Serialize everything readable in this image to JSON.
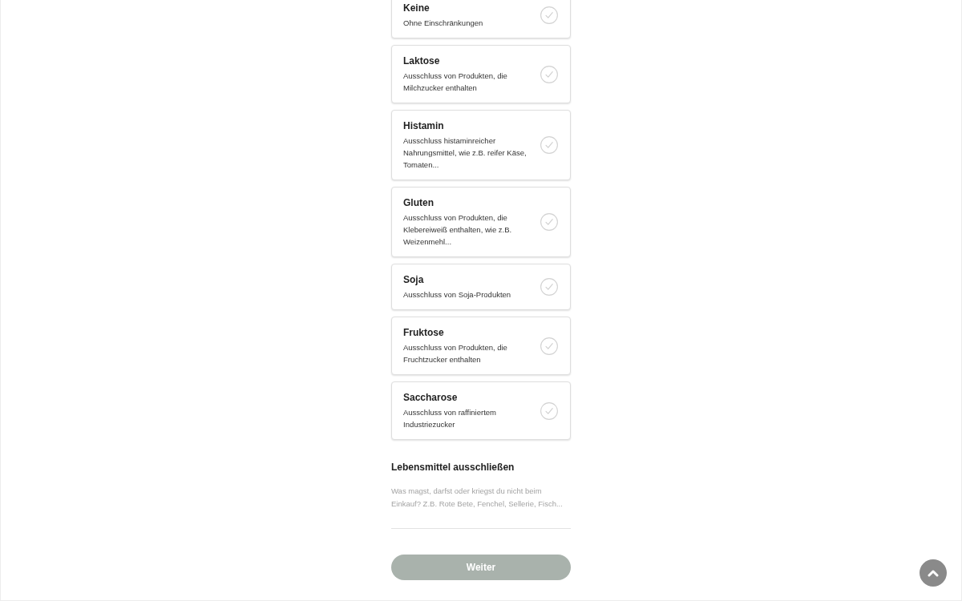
{
  "options": [
    {
      "title": "Keine",
      "description": "Ohne Einschränkungen",
      "selected": false
    },
    {
      "title": "Laktose",
      "description": "Ausschluss von Produkten, die Milchzucker enthalten",
      "selected": false
    },
    {
      "title": "Histamin",
      "description": "Ausschluss histaminreicher Nahrungsmittel, wie z.B. reifer Käse, Tomaten...",
      "selected": false
    },
    {
      "title": "Gluten",
      "description": "Ausschluss von Produkten, die Klebereiweiß enthalten, wie z.B. Weizenmehl...",
      "selected": false
    },
    {
      "title": "Soja",
      "description": "Ausschluss von Soja-Produkten",
      "selected": false
    },
    {
      "title": "Fruktose",
      "description": "Ausschluss von Produkten, die Fruchtzucker enthalten",
      "selected": false
    },
    {
      "title": "Saccharose",
      "description": "Ausschluss von raffiniertem Industriezucker",
      "selected": false
    }
  ],
  "exclude_section": {
    "heading": "Lebensmittel ausschließen",
    "placeholder": "Was magst, darfst oder kriegst du nicht beim Einkauf? Z.B. Rote Bete, Fenchel, Sellerie, Fisch..."
  },
  "next_button": {
    "label": "Weiter",
    "disabled": true
  }
}
